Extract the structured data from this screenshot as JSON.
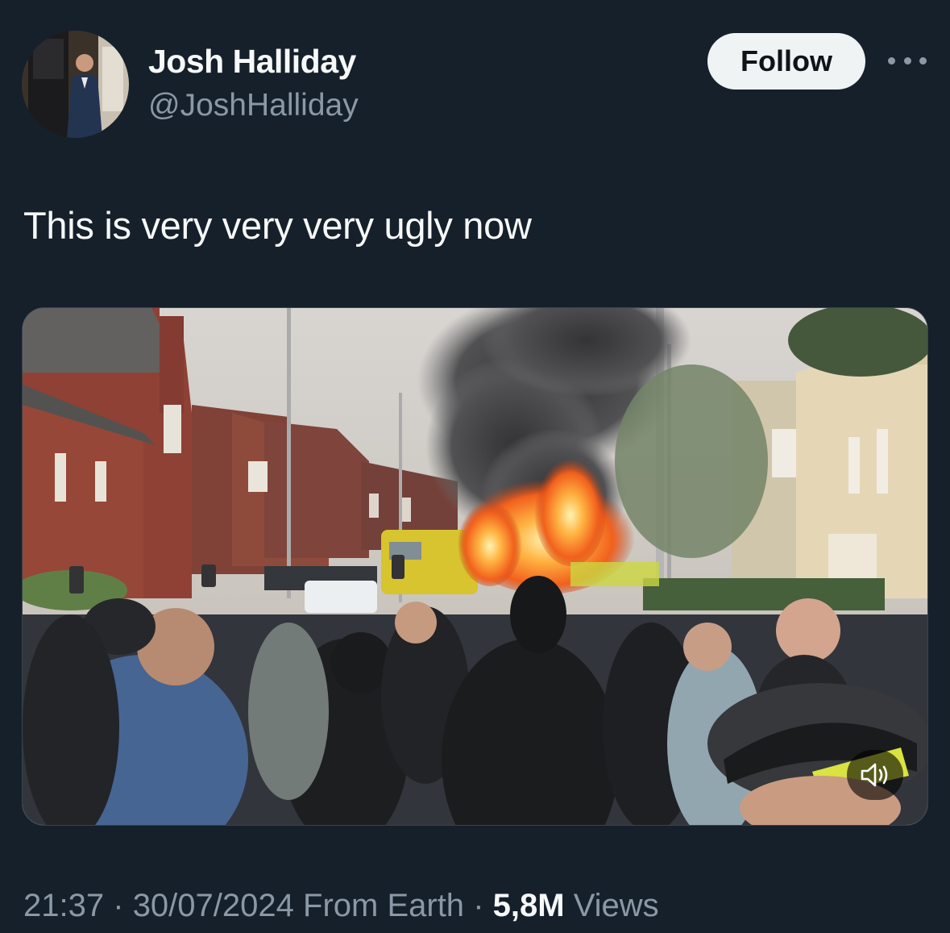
{
  "author": {
    "display_name": "Josh Halliday",
    "handle": "@JoshHalliday"
  },
  "actions": {
    "follow_label": "Follow",
    "more_icon": "more-horizontal-icon"
  },
  "tweet": {
    "text": "This is very very very ugly now",
    "media": {
      "type": "video",
      "mute_icon": "speaker-muted-icon"
    }
  },
  "meta": {
    "time": "21:37",
    "separator": "·",
    "date": "30/07/2024",
    "source": "From Earth",
    "views_count": "5,8M",
    "views_label": "Views"
  },
  "colors": {
    "background": "#15202b",
    "primary_text": "#f7f9f9",
    "secondary_text": "#8b98a5",
    "follow_button_bg": "#eff3f4"
  }
}
